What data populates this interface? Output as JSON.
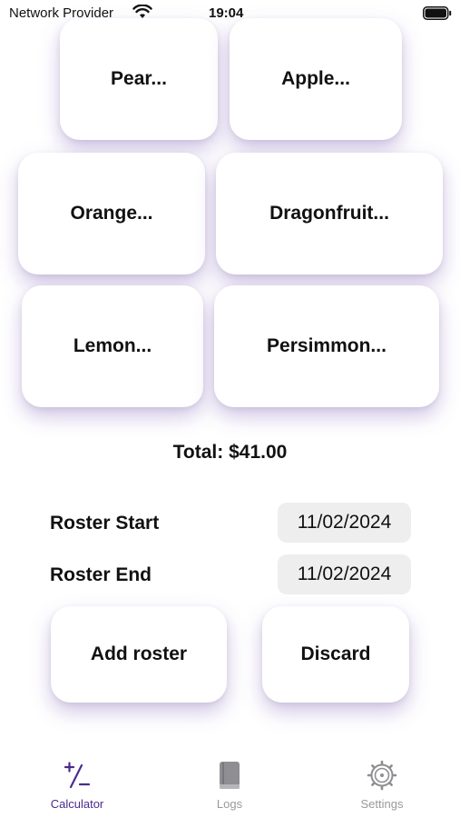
{
  "status_bar": {
    "carrier": "Network Provider",
    "time": "19:04"
  },
  "items": [
    {
      "label": "Pear..."
    },
    {
      "label": "Apple..."
    },
    {
      "label": "Orange..."
    },
    {
      "label": "Dragonfruit..."
    },
    {
      "label": "Lemon..."
    },
    {
      "label": "Persimmon..."
    }
  ],
  "total": {
    "text": "Total: $41.00"
  },
  "roster": {
    "start_label": "Roster Start",
    "start_value": "11/02/2024",
    "end_label": "Roster End",
    "end_value": "11/02/2024"
  },
  "actions": {
    "add_label": "Add roster",
    "discard_label": "Discard"
  },
  "tabs": [
    {
      "label": "Calculator",
      "icon": "plus-minus-icon",
      "active": true
    },
    {
      "label": "Logs",
      "icon": "book-icon",
      "active": false
    },
    {
      "label": "Settings",
      "icon": "gear-icon",
      "active": false
    }
  ],
  "colors": {
    "accent": "#4b2b8c",
    "inactive": "#9a9a9e",
    "shadow": "#b9a4e0"
  }
}
